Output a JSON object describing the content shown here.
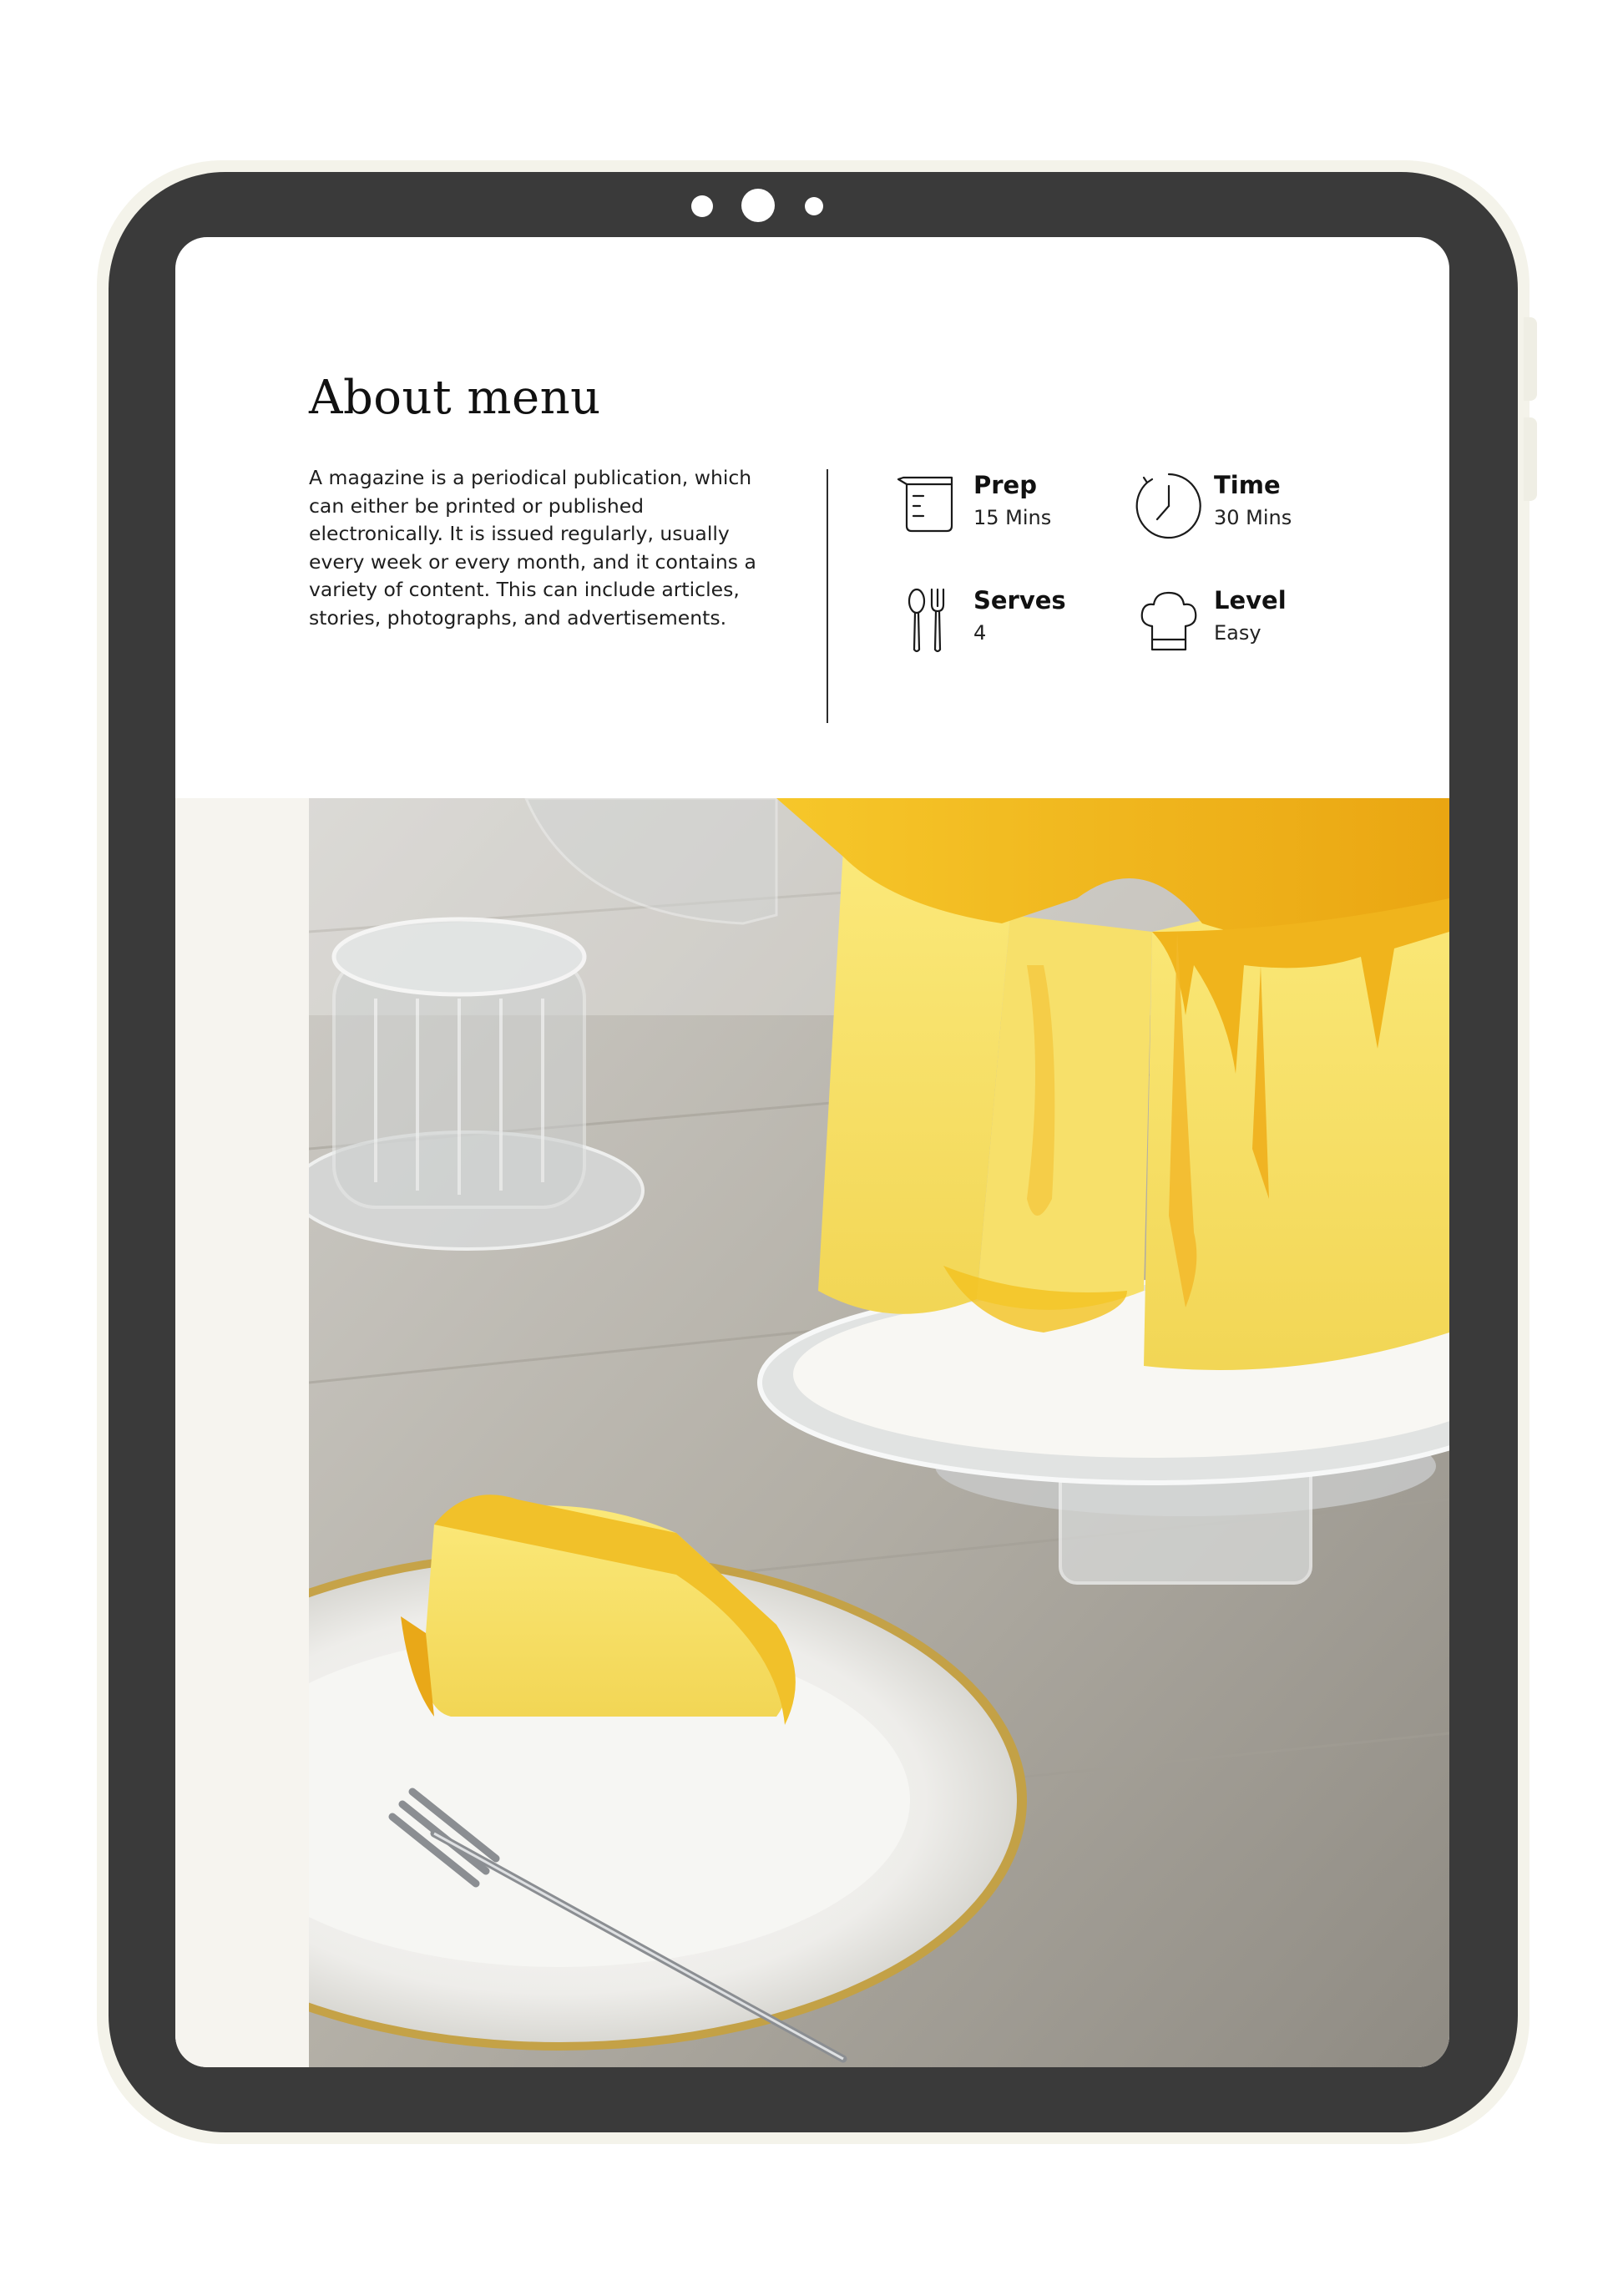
{
  "menu": {
    "title": "About menu",
    "description": "A magazine is a periodical publication, which can either be printed or published electronically. It is issued regularly, usually every week or every month, and it contains a variety of content. This can include articles, stories, photographs, and advertisements."
  },
  "stats": [
    {
      "label": "Prep",
      "value": "15 Mins",
      "icon": "measuring-cup-icon"
    },
    {
      "label": "Time",
      "value": "30 Mins",
      "icon": "clock-icon"
    },
    {
      "label": "Serves",
      "value": "4",
      "icon": "spoon-fork-icon"
    },
    {
      "label": "Level",
      "value": "Easy",
      "icon": "chef-hat-icon"
    }
  ],
  "photo": {
    "subject": "chiffon-cake-photo"
  },
  "colors": {
    "device": "#3a3a3a",
    "screen": "#ffffff",
    "band": "#f6f4ef",
    "cake": "#f3dc55",
    "glaze": "#f1b51d"
  }
}
